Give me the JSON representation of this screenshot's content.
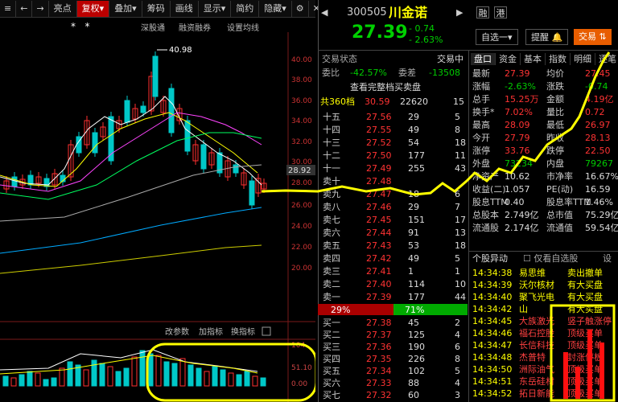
{
  "toolbar": {
    "items": [
      "≡",
      "←",
      "→",
      "亮点",
      "复权",
      "叠加",
      "筹码",
      "画线",
      "显示",
      "简约",
      "隐藏"
    ],
    "fuquan": "复权▾",
    "diejia": "叠加▾",
    "xianshi": "显示▾",
    "yincang": "隐藏▾",
    "settings": "⚙",
    "close": "✕"
  },
  "subbar": {
    "shenbutong": "深股通",
    "rongzi": "融资融券",
    "shezhi": "设置均线",
    "stars": "*  *                               *  *  *  *"
  },
  "kline": {
    "high_label": "40.98",
    "price_label": "28.92",
    "yticks": [
      "40.00",
      "38.00",
      "36.00",
      "34.00",
      "32.00",
      "30.00",
      "28.00",
      "26.00",
      "24.00",
      "22.00",
      "20.00"
    ],
    "vol_ticks": [
      "104.",
      "51.10",
      "0.00"
    ],
    "vol_bar": {
      "gaicanshu": "改参数",
      "jiazhibiao": "加指标",
      "huanzhibiao": "换指标"
    }
  },
  "stock": {
    "code": "300505",
    "name": "川金诺",
    "rong": "融",
    "gang": "港",
    "price": "27.39",
    "change": "- 0.74",
    "pct": "- 2.63%",
    "zixuan": "自选一▾",
    "tixing": "提醒 🔔",
    "jiaoyi": "交易 ⇅"
  },
  "status": {
    "tab1": "交易状态",
    "tab2": "交易中",
    "weibi_lbl": "委比",
    "weibi": "-42.57%",
    "weicha_lbl": "委差",
    "weicha": "-13508",
    "view_full": "查看完整档买卖盘",
    "dang_lbl": "共360档",
    "dang_p": "30.59",
    "dang_v": "22620",
    "dang_n": "15"
  },
  "orderbook": {
    "sells": [
      {
        "lbl": "十五",
        "p": "27.56",
        "v": "29",
        "n": "5"
      },
      {
        "lbl": "十四",
        "p": "27.55",
        "v": "49",
        "n": "8"
      },
      {
        "lbl": "十三",
        "p": "27.52",
        "v": "54",
        "n": "18"
      },
      {
        "lbl": "十二",
        "p": "27.50",
        "v": "177",
        "n": "11"
      },
      {
        "lbl": "十一",
        "p": "27.49",
        "v": "255",
        "n": "43"
      },
      {
        "lbl": "卖十",
        "p": "27.48",
        "v": "",
        "n": ""
      },
      {
        "lbl": "卖九",
        "p": "27.47",
        "v": "18",
        "n": "6"
      },
      {
        "lbl": "卖八",
        "p": "27.46",
        "v": "29",
        "n": "7"
      },
      {
        "lbl": "卖七",
        "p": "27.45",
        "v": "151",
        "n": "17"
      },
      {
        "lbl": "卖六",
        "p": "27.44",
        "v": "91",
        "n": "13"
      },
      {
        "lbl": "卖五",
        "p": "27.43",
        "v": "53",
        "n": "18"
      },
      {
        "lbl": "卖四",
        "p": "27.42",
        "v": "49",
        "n": "5"
      },
      {
        "lbl": "卖三",
        "p": "27.41",
        "v": "1",
        "n": "1"
      },
      {
        "lbl": "卖二",
        "p": "27.40",
        "v": "114",
        "n": "10"
      },
      {
        "lbl": "卖一",
        "p": "27.39",
        "v": "177",
        "n": "44"
      }
    ],
    "ratio_l": "29%",
    "ratio_r": "71%",
    "buys": [
      {
        "lbl": "买一",
        "p": "27.38",
        "v": "45",
        "n": "2"
      },
      {
        "lbl": "买二",
        "p": "27.37",
        "v": "125",
        "n": "4"
      },
      {
        "lbl": "买三",
        "p": "27.36",
        "v": "190",
        "n": "6"
      },
      {
        "lbl": "买四",
        "p": "27.35",
        "v": "226",
        "n": "8"
      },
      {
        "lbl": "买五",
        "p": "27.34",
        "v": "102",
        "n": "5"
      },
      {
        "lbl": "买六",
        "p": "27.33",
        "v": "88",
        "n": "4"
      },
      {
        "lbl": "买七",
        "p": "27.32",
        "v": "60",
        "n": "3"
      }
    ]
  },
  "tabs": [
    "盘口",
    "资金",
    "基本",
    "指数",
    "明细",
    "逐笔"
  ],
  "quote": {
    "rows": [
      [
        "最新",
        "27.39",
        "均价",
        "27.45"
      ],
      [
        "涨幅",
        "-2.63%",
        "涨跌",
        "-0.74"
      ],
      [
        "总手",
        "15.25万",
        "金额",
        "4.19亿"
      ],
      [
        "换手*",
        "7.02%",
        "量比",
        "0.72"
      ],
      [
        "最高",
        "28.09",
        "最低",
        "26.97"
      ],
      [
        "今开",
        "27.79",
        "昨收",
        "28.13"
      ],
      [
        "涨停",
        "33.76",
        "跌停",
        "22.50"
      ],
      [
        "外盘",
        "73234",
        "内盘",
        "79267"
      ],
      [
        "净资产",
        "10.62",
        "市净率",
        "16.67%"
      ],
      [
        "收益(二)",
        "1.057",
        "PE(动)",
        "16.59"
      ],
      [
        "股息TTM",
        "0.40",
        "股息率TTM",
        "1.46%"
      ],
      [
        "总股本",
        "2.749亿",
        "总市值",
        "75.29亿"
      ],
      [
        "流通股",
        "2.174亿",
        "流通值",
        "59.54亿"
      ]
    ]
  },
  "yidong": {
    "title": "个股异动",
    "check": "仅看自选股",
    "gear": "设",
    "rows": [
      [
        "14:34:38",
        "易思维",
        "卖出撤单"
      ],
      [
        "14:34:39",
        "沃尔核材",
        "有大买盘"
      ],
      [
        "14:34:40",
        "聚飞光电",
        "有大买盘"
      ],
      [
        "14:34:42",
        "山",
        "有大买盘"
      ],
      [
        "14:34:45",
        "大族激光",
        "竖子触涨停"
      ],
      [
        "14:34:46",
        "福石控股",
        "顶级买单"
      ],
      [
        "14:34:47",
        "长信科技",
        "顶级买单"
      ],
      [
        "14:34:48",
        "杰普特",
        "封涨停板"
      ],
      [
        "14:34:50",
        "洲际油气",
        "顶级买单"
      ],
      [
        "14:34:51",
        "东岳硅材",
        "顶级买单"
      ],
      [
        "14:34:52",
        "拓日新能",
        "顶级买单"
      ]
    ]
  },
  "colors": {
    "up": "#ff3030",
    "down": "#00c8c8",
    "accent": "#ffff00",
    "bg": "#000000"
  }
}
